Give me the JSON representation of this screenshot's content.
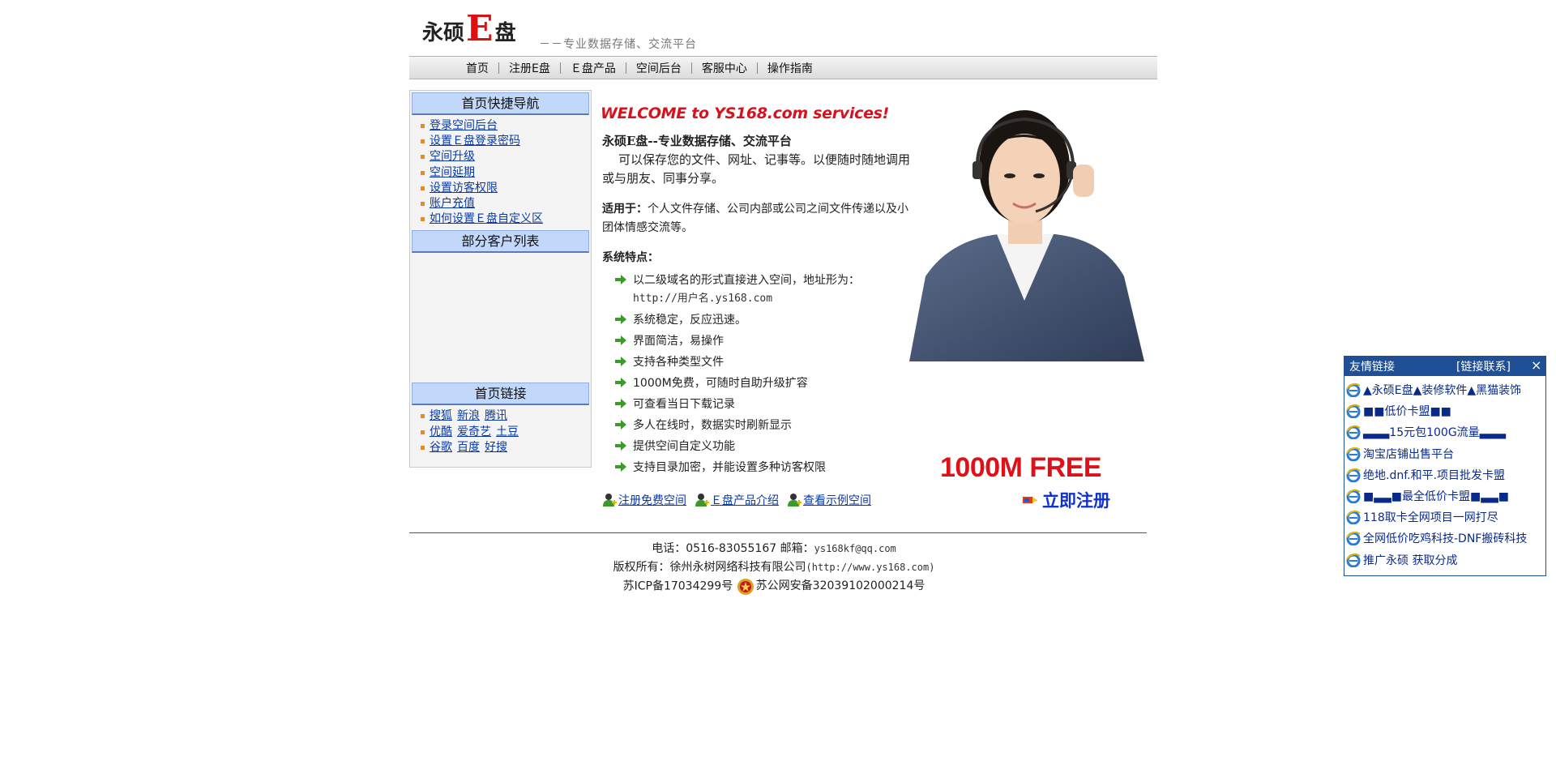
{
  "header": {
    "logo_left": "永硕",
    "logo_e": "E",
    "logo_right": "盘",
    "slogan": "－－专业数据存储、交流平台"
  },
  "nav": [
    "首页",
    "注册E盘",
    "Ｅ盘产品",
    "空间后台",
    "客服中心",
    "操作指南"
  ],
  "sidebar": {
    "quick_nav_title": "首页快捷导航",
    "quick_nav": [
      "登录空间后台",
      "设置Ｅ盘登录密码",
      "空间升级",
      "空间延期",
      "设置访客权限",
      "账户充值",
      "如何设置Ｅ盘自定义区"
    ],
    "clients_title": "部分客户列表",
    "links_title": "首页链接",
    "links": [
      [
        "搜狐",
        "新浪",
        "腾讯"
      ],
      [
        "优酷",
        "爱奇艺",
        "土豆"
      ],
      [
        "谷歌",
        "百度",
        "好搜"
      ]
    ]
  },
  "main": {
    "welcome": "WELCOME to YS168.com services!",
    "intro_title": "永硕E盘--专业数据存储、交流平台",
    "intro_desc": "可以保存您的文件、网址、记事等。以便随时随地调用或与朋友、同事分享。",
    "suit_label": "适用于：",
    "suit_text": "个人文件存储、公司内部或公司之间文件传递以及小团体情感交流等。",
    "features_title": "系统特点：",
    "feature1_a": "以二级域名的形式直接进入空间，地址形为：",
    "feature1_b": "http://用户名.ys168.com",
    "features": [
      "系统稳定，反应迅速。",
      "界面简洁，易操作",
      "支持各种类型文件",
      "1000M免费，可随时自助升级扩容",
      "可查看当日下载记录",
      "多人在线时，数据实时刷新显示",
      "提供空间自定义功能",
      "支持目录加密，并能设置多种访客权限"
    ],
    "quick_links": [
      "注册免费空间",
      "Ｅ盘产品介绍",
      "查看示例空间"
    ],
    "free_text": "1000M FREE",
    "register_now": "立即注册"
  },
  "footer": {
    "phone_label": "电话：0516-83055167",
    "email_label": "邮箱：",
    "email": "ys168kf@qq.com",
    "copyright": "版权所有：徐州永树网络科技有限公司",
    "copyright_url": "(http://www.ys168.com)",
    "icp": "苏ICP备17034299号",
    "police": "苏公网安备32039102000214号"
  },
  "friends": {
    "title": "友情链接",
    "contact": "[链接联系]",
    "close": "×",
    "items": [
      "▲永硕E盘▲装修软件▲黑猫装饰",
      "■■低价卡盟■■",
      "▃▃▃15元包100G流量▃▃▃",
      "淘宝店铺出售平台",
      "绝地.dnf.和平.项目批发卡盟",
      "■▃▃■最全低价卡盟■▃▃■",
      "118取卡全网项目一网打尽",
      "全网低价吃鸡科技-DNF搬砖科技",
      "推广永硕 获取分成"
    ]
  },
  "colors": {
    "accent_red": "#d8121c",
    "link_blue": "#0a3aa8",
    "sidebar_head": "#c1d8fb",
    "friends_head": "#1f4f95"
  }
}
